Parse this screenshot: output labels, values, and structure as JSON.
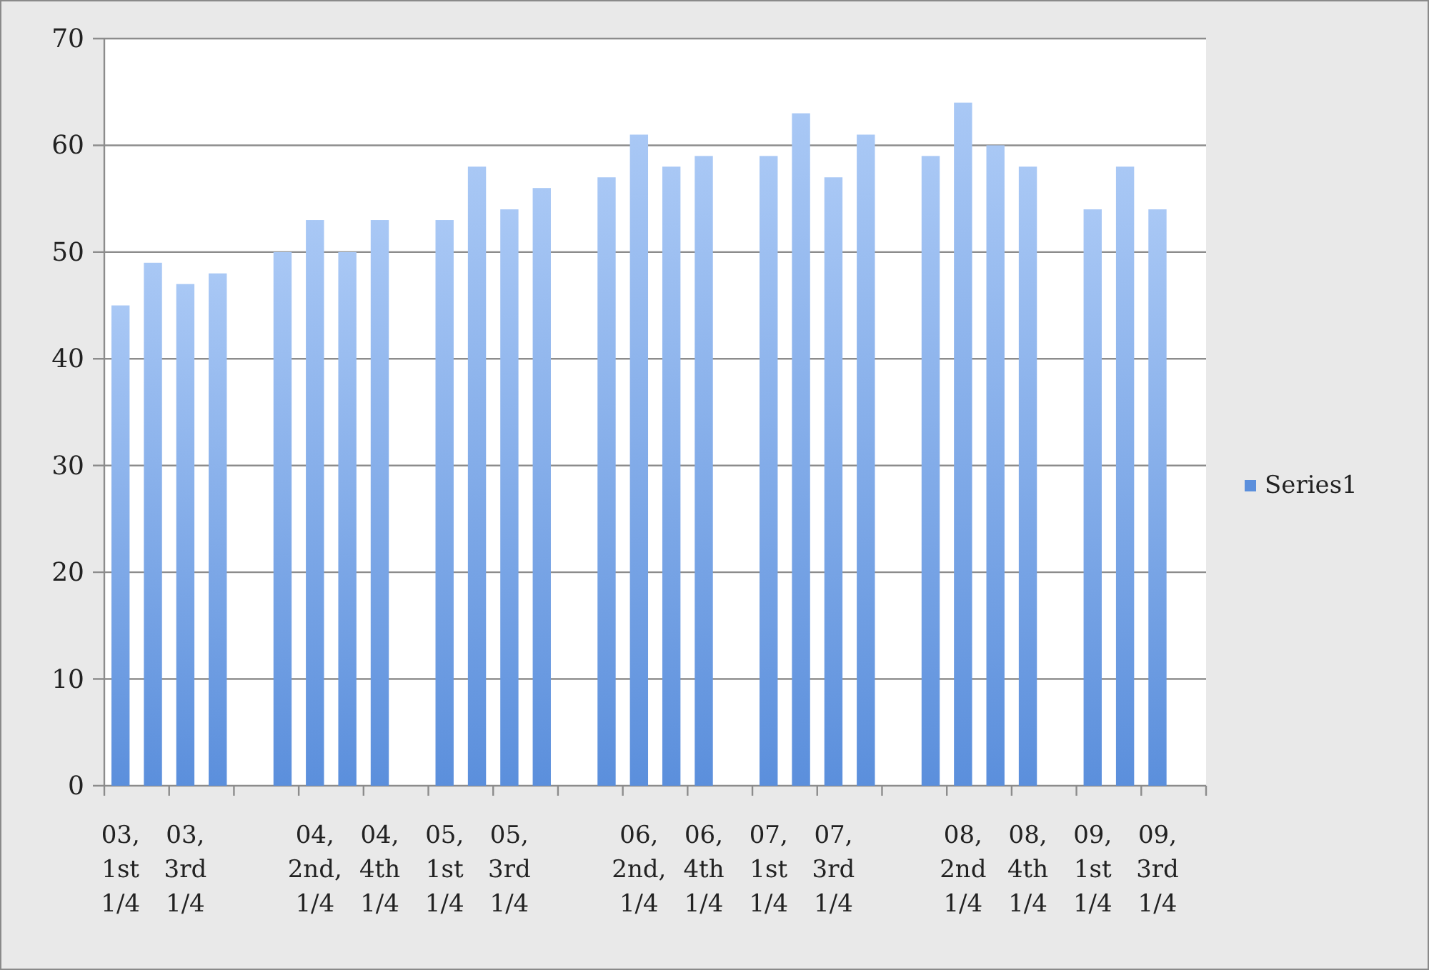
{
  "chart_data": {
    "type": "bar",
    "grid": true,
    "categories": [
      "03, 1st 1/4",
      null,
      "03, 3rd 1/4",
      null,
      null,
      null,
      "04, 2nd, 1/4",
      null,
      "04, 4th 1/4",
      null,
      "05, 1st 1/4",
      null,
      "05, 3rd 1/4",
      null,
      null,
      null,
      "06, 2nd, 1/4",
      null,
      "06, 4th 1/4",
      null,
      "07, 1st 1/4",
      null,
      "07, 3rd 1/4",
      null,
      null,
      null,
      "08, 2nd 1/4",
      null,
      "08, 4th 1/4",
      null,
      "09, 1st 1/4",
      null,
      "09, 3rd 1/4",
      null
    ],
    "series": [
      {
        "name": "Series1",
        "color": "#5b8fdc",
        "values": [
          45,
          49,
          47,
          48,
          null,
          50,
          53,
          50,
          53,
          null,
          53,
          58,
          54,
          56,
          null,
          57,
          61,
          58,
          59,
          null,
          59,
          63,
          57,
          61,
          null,
          59,
          64,
          60,
          58,
          null,
          54,
          58,
          54,
          null
        ]
      }
    ],
    "ylim": [
      0,
      70
    ],
    "yticks": [
      0,
      10,
      20,
      30,
      40,
      50,
      60,
      70
    ]
  }
}
